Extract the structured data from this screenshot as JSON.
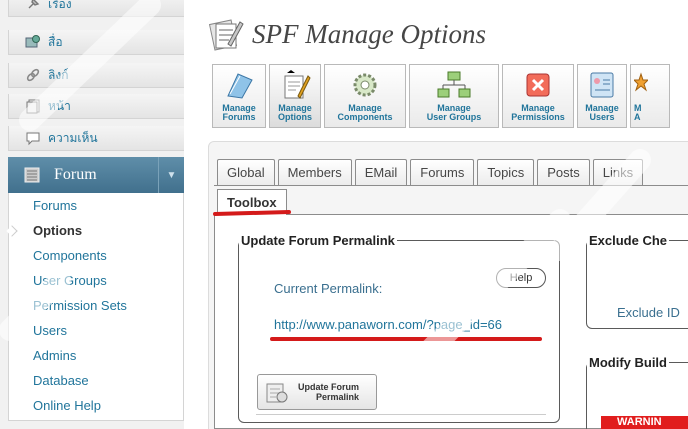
{
  "sidebar": {
    "top_items": [
      {
        "label": "เรื่อง",
        "icon": "pin-icon"
      },
      {
        "label": "สื่อ",
        "icon": "media-icon"
      },
      {
        "label": "ลิงก์",
        "icon": "link-icon"
      },
      {
        "label": "หน้า",
        "icon": "page-icon"
      },
      {
        "label": "ความเห็น",
        "icon": "comment-icon"
      }
    ],
    "forum_header": "Forum",
    "submenu": [
      "Forums",
      "Options",
      "Components",
      "User Groups",
      "Permission Sets",
      "Users",
      "Admins",
      "Database",
      "Online Help"
    ],
    "current": "Options"
  },
  "title": "SPF Manage Options",
  "toolbar": [
    {
      "line1": "Manage",
      "line2": "Forums",
      "icon": "forums-icon"
    },
    {
      "line1": "Manage",
      "line2": "Options",
      "icon": "options-icon"
    },
    {
      "line1": "Manage",
      "line2": "Components",
      "icon": "components-icon"
    },
    {
      "line1": "Manage",
      "line2": "User Groups",
      "icon": "user-groups-icon"
    },
    {
      "line1": "Manage",
      "line2": "Permissions",
      "icon": "permissions-icon"
    },
    {
      "line1": "Manage",
      "line2": "Users",
      "icon": "users-icon"
    },
    {
      "line1": "M",
      "line2": "A",
      "icon": "admins-icon"
    }
  ],
  "tabs": [
    "Global",
    "Members",
    "EMail",
    "Forums",
    "Topics",
    "Posts",
    "Links"
  ],
  "active_tab": "Toolbox",
  "permalink_section": {
    "legend": "Update Forum Permalink",
    "current_label": "Current Permalink:",
    "help": "Help",
    "url": "http://www.panaworn.com/?page_id=66",
    "update_button_line1": "Update Forum",
    "update_button_line2": "Permalink"
  },
  "exclude_section": {
    "legend": "Exclude Che",
    "label": "Exclude ID"
  },
  "modify_section": {
    "legend": "Modify Build"
  },
  "warning": "WARNIN",
  "colors": {
    "sidebar_accent": "#4a7c9b",
    "link": "#21759b",
    "highlight_red": "#d41a1a"
  }
}
